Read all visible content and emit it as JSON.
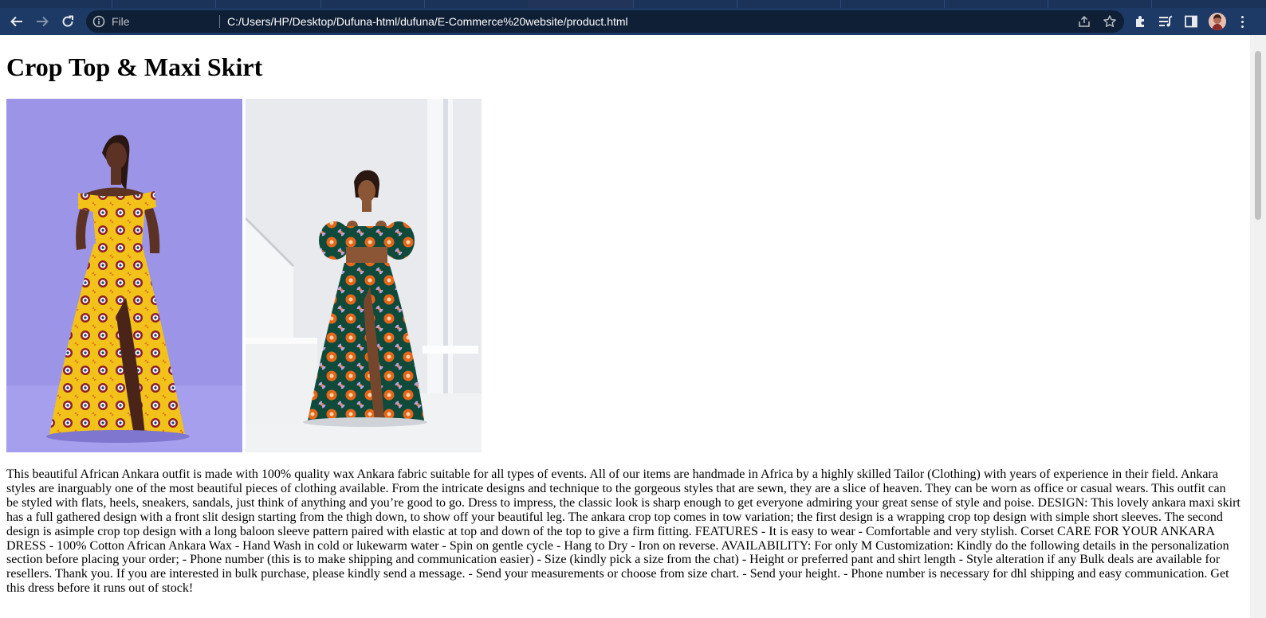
{
  "browser": {
    "scheme_label": "File",
    "url": "C:/Users/HP/Desktop/Dufuna-html/dufuna/E-Commerce%20website/product.html",
    "tab_count": 12,
    "active_tab_index": 5
  },
  "product": {
    "title": "Crop Top & Maxi Skirt",
    "images": [
      {
        "name": "product-image-yellow-dress",
        "background": "#9b93e6"
      },
      {
        "name": "product-image-crop-top-set",
        "background": "#e9ebee"
      }
    ],
    "description": "This beautiful African Ankara outfit is made with 100% quality wax Ankara fabric suitable for all types of events. All of our items are handmade in Africa by a highly skilled Tailor (Clothing) with years of experience in their field. Ankara styles are inarguably one of the most beautiful pieces of clothing available. From the intricate designs and technique to the gorgeous styles that are sewn, they are a slice of heaven. They can be worn as office or casual wears. This outfit can be styled with flats, heels, sneakers, sandals, just think of anything and you’re good to go. Dress to impress, the classic look is sharp enough to get everyone admiring your great sense of style and poise. DESIGN: This lovely ankara maxi skirt has a full gathered design with a front slit design starting from the thigh down, to show off your beautiful leg. The ankara crop top comes in tow variation; the first design is a wrapping crop top design with simple short sleeves. The second design is asimple crop top design with a long baloon sleeve pattern paired with elastic at top and down of the top to give a firm fitting. FEATURES - It is easy to wear - Comfortable and very stylish. Corset CARE FOR YOUR ANKARA DRESS - 100% Cotton African Ankara Wax - Hand Wash in cold or lukewarm water - Spin on gentle cycle - Hang to Dry - Iron on reverse. AVAILABILITY: For only M Customization: Kindly do the following details in the personalization section before placing your order; - Phone number (this is to make shipping and communication easier) - Size (kindly pick a size from the chat) - Height or preferred pant and shirt length - Style alteration if any Bulk deals are available for resellers. Thank you. If you are interested in bulk purchase, please kindly send a message. - Send your measurements or choose from size chart. - Send your height. - Phone number is necessary for dhl shipping and easy communication. Get this dress before it runs out of stock!"
  },
  "colors": {
    "chrome_dark": "#1b3358",
    "toolbar": "#1d3a66",
    "omnibox": "#0f1f36",
    "page_bg": "#ffffff"
  },
  "icons": {
    "back": "arrow-left-icon",
    "forward": "arrow-right-icon",
    "reload": "reload-icon",
    "site_info": "info-circle-icon",
    "share": "share-icon",
    "bookmark": "star-icon",
    "extensions": "puzzle-icon",
    "media": "media-queue-icon",
    "side_panel": "side-panel-icon",
    "profile": "avatar",
    "menu": "kebab-menu-icon"
  }
}
